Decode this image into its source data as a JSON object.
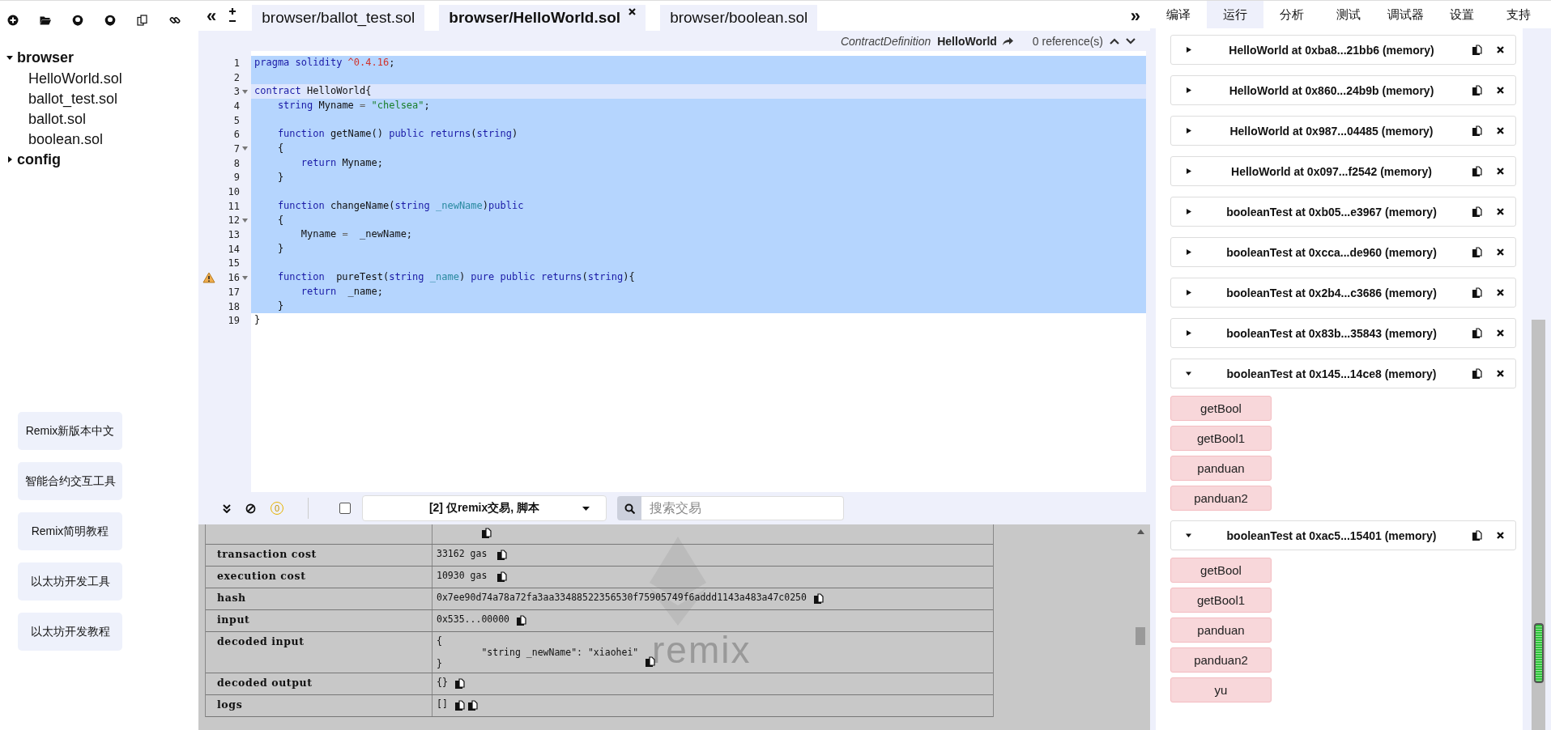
{
  "file_tree": [
    {
      "label": "browser",
      "expanded": true,
      "children": [
        {
          "label": "HelloWorld.sol"
        },
        {
          "label": "ballot_test.sol"
        },
        {
          "label": "ballot.sol"
        },
        {
          "label": "boolean.sol"
        }
      ]
    },
    {
      "label": "config",
      "expanded": false
    }
  ],
  "side_buttons": [
    "Remix新版本中文",
    "智能合约交互工具",
    "Remix简明教程",
    "以太坊开发工具",
    "以太坊开发教程"
  ],
  "editor_nav": {
    "collapse_left": "«",
    "collapse_right": "»"
  },
  "editor_tabs": [
    {
      "label": "browser/ballot_test.sol",
      "selected": false
    },
    {
      "label": "browser/HelloWorld.sol",
      "selected": true
    },
    {
      "label": "browser/boolean.sol",
      "selected": false
    }
  ],
  "editor_header": {
    "kind_label": "ContractDefinition",
    "name": "HelloWorld",
    "references": "0 reference(s)"
  },
  "code_lines": [
    {
      "num": "1",
      "selected": true,
      "active": false,
      "tokens": [
        {
          "t": "pragma solidity ",
          "kind": "kw"
        },
        {
          "t": "^0.4.16",
          "kind": "num"
        },
        {
          "t": ";",
          "kind": "plain"
        }
      ]
    },
    {
      "num": "2",
      "selected": true,
      "active": false
    },
    {
      "num": "3",
      "selected": true,
      "active": true,
      "fold": true,
      "tokens": [
        {
          "t": "contract ",
          "kind": "kw"
        },
        {
          "t": "HelloWorld{",
          "kind": "plain"
        }
      ]
    },
    {
      "num": "4",
      "selected": true,
      "active": false,
      "tokens": [
        {
          "t": "    string ",
          "kind": "kw"
        },
        {
          "t": "Myname ",
          "kind": "plain"
        },
        {
          "t": "= ",
          "kind": "op"
        },
        {
          "t": "\"chelsea\"",
          "kind": "str"
        },
        {
          "t": ";",
          "kind": "plain"
        }
      ]
    },
    {
      "num": "5",
      "selected": true,
      "active": false
    },
    {
      "num": "6",
      "selected": true,
      "active": false,
      "tokens": [
        {
          "t": "    function ",
          "kind": "kw"
        },
        {
          "t": "getName() ",
          "kind": "plain"
        },
        {
          "t": "public returns",
          "kind": "kw"
        },
        {
          "t": "(",
          "kind": "plain"
        },
        {
          "t": "string",
          "kind": "kw"
        },
        {
          "t": ")",
          "kind": "plain"
        }
      ]
    },
    {
      "num": "7",
      "selected": true,
      "active": false,
      "fold": true,
      "tokens": [
        {
          "t": "    {",
          "kind": "plain"
        }
      ]
    },
    {
      "num": "8",
      "selected": true,
      "active": false,
      "tokens": [
        {
          "t": "        return ",
          "kind": "kw"
        },
        {
          "t": "Myname;",
          "kind": "plain"
        }
      ]
    },
    {
      "num": "9",
      "selected": true,
      "active": false,
      "tokens": [
        {
          "t": "    }",
          "kind": "plain"
        }
      ]
    },
    {
      "num": "10",
      "selected": true,
      "active": false
    },
    {
      "num": "11",
      "selected": true,
      "active": false,
      "tokens": [
        {
          "t": "    function ",
          "kind": "kw"
        },
        {
          "t": "changeName(",
          "kind": "plain"
        },
        {
          "t": "string ",
          "kind": "kw"
        },
        {
          "t": "_newName",
          "kind": "param"
        },
        {
          "t": ")",
          "kind": "plain"
        },
        {
          "t": "public",
          "kind": "kw"
        }
      ]
    },
    {
      "num": "12",
      "selected": true,
      "active": false,
      "fold": true,
      "tokens": [
        {
          "t": "    {",
          "kind": "plain"
        }
      ]
    },
    {
      "num": "13",
      "selected": true,
      "active": false,
      "tokens": [
        {
          "t": "        Myname ",
          "kind": "plain"
        },
        {
          "t": "= ",
          "kind": "op"
        },
        {
          "t": " _newName;",
          "kind": "plain"
        }
      ]
    },
    {
      "num": "14",
      "selected": true,
      "active": false,
      "tokens": [
        {
          "t": "    }",
          "kind": "plain"
        }
      ]
    },
    {
      "num": "15",
      "selected": true,
      "active": false
    },
    {
      "num": "16",
      "selected": true,
      "active": false,
      "fold": true,
      "warning": true,
      "tokens": [
        {
          "t": "    function ",
          "kind": "kw"
        },
        {
          "t": " pureTest(",
          "kind": "plain"
        },
        {
          "t": "string ",
          "kind": "kw"
        },
        {
          "t": "_name",
          "kind": "param"
        },
        {
          "t": ") ",
          "kind": "plain"
        },
        {
          "t": "pure public returns",
          "kind": "kw"
        },
        {
          "t": "(",
          "kind": "plain"
        },
        {
          "t": "string",
          "kind": "kw"
        },
        {
          "t": "){",
          "kind": "plain"
        }
      ]
    },
    {
      "num": "17",
      "selected": true,
      "active": false,
      "tokens": [
        {
          "t": "        return ",
          "kind": "kw"
        },
        {
          "t": " _name;",
          "kind": "plain"
        }
      ]
    },
    {
      "num": "18",
      "selected": true,
      "active": false,
      "tokens": [
        {
          "t": "    }",
          "kind": "plain"
        }
      ]
    },
    {
      "num": "19",
      "selected": false,
      "active": false,
      "tokens": [
        {
          "t": "}",
          "kind": "plain"
        }
      ]
    }
  ],
  "terminal": {
    "badge": "0",
    "filter_checked": false,
    "filter": "[2] 仅remix交易, 脚本",
    "search": {
      "placeholder": "搜索交易"
    },
    "watermark": "remix",
    "rows": [
      {
        "actions": [
          {
            "kind": "copy"
          }
        ]
      },
      {
        "label": "transaction cost",
        "value": "33162 gas",
        "actions": [
          {
            "kind": "copy"
          }
        ]
      },
      {
        "label": "execution cost",
        "value": "10930 gas",
        "actions": [
          {
            "kind": "copy"
          }
        ]
      },
      {
        "label": "hash",
        "value": "0x7ee90d74a78a72fa3aa33488522356530f75905749f6addd1143a483a47c0250",
        "actions": [
          {
            "kind": "copy"
          }
        ]
      },
      {
        "label": "input",
        "value": "0x535...00000",
        "actions": [
          {
            "kind": "copy"
          }
        ]
      },
      {
        "label": "decoded input",
        "value": "{\n\t\"string _newName\": \"xiaohei\"\n}",
        "actions": [
          {
            "kind": "copy"
          }
        ]
      },
      {
        "label": "decoded output",
        "value": "{}",
        "actions": [
          {
            "kind": "copy"
          }
        ]
      },
      {
        "label": "logs",
        "value": "[]",
        "actions": [
          {
            "kind": "copy"
          },
          {
            "kind": "copy"
          }
        ]
      }
    ]
  },
  "right_tabs": [
    {
      "label": "编译",
      "selected": false
    },
    {
      "label": "运行",
      "selected": true
    },
    {
      "label": "分析",
      "selected": false
    },
    {
      "label": "测试",
      "selected": false
    },
    {
      "label": "调试器",
      "selected": false
    },
    {
      "label": "设置",
      "selected": false
    },
    {
      "label": "支持",
      "selected": false
    }
  ],
  "instances": [
    {
      "title": "HelloWorld at 0xba8...21bb6 (memory)",
      "expanded": false
    },
    {
      "title": "HelloWorld at 0x860...24b9b (memory)",
      "expanded": false
    },
    {
      "title": "HelloWorld at 0x987...04485 (memory)",
      "expanded": false
    },
    {
      "title": "HelloWorld at 0x097...f2542 (memory)",
      "expanded": false
    },
    {
      "title": "booleanTest at 0xb05...e3967 (memory)",
      "expanded": false
    },
    {
      "title": "booleanTest at 0xcca...de960 (memory)",
      "expanded": false
    },
    {
      "title": "booleanTest at 0x2b4...c3686 (memory)",
      "expanded": false
    },
    {
      "title": "booleanTest at 0x83b...35843 (memory)",
      "expanded": false
    },
    {
      "title": "booleanTest at 0x145...14ce8 (memory)",
      "expanded": true,
      "functions": [
        "getBool",
        "getBool1",
        "panduan",
        "panduan2"
      ]
    },
    {
      "title": "booleanTest at 0xac5...15401 (memory)",
      "expanded": true,
      "functions": [
        "getBool",
        "getBool1",
        "panduan",
        "panduan2",
        "yu"
      ]
    }
  ]
}
